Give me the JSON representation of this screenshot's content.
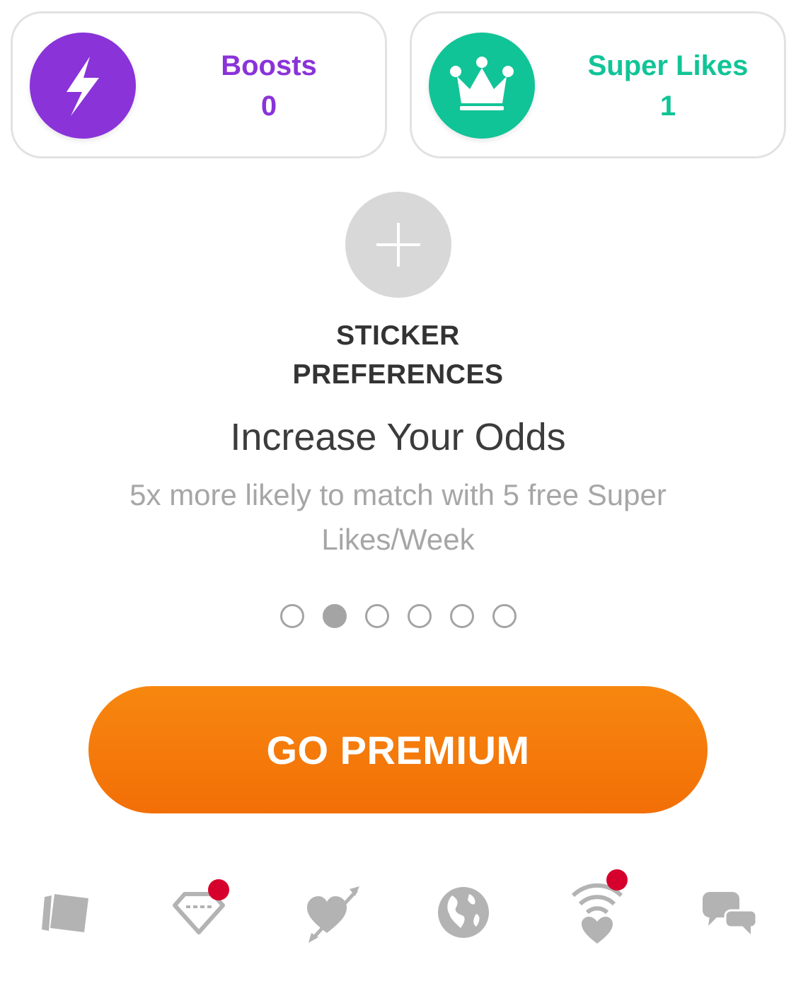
{
  "stats": {
    "boosts": {
      "label": "Boosts",
      "count": "0",
      "icon": "lightning-icon",
      "color": "#8a33d9"
    },
    "super_likes": {
      "label": "Super Likes",
      "count": "1",
      "icon": "crown-icon",
      "color": "#11c497"
    }
  },
  "sticker": {
    "icon": "plus-icon",
    "title_line1": "STICKER",
    "title_line2": "PREFERENCES"
  },
  "promo": {
    "title": "Increase Your Odds",
    "subtitle": "5x more likely to match with 5 free Super Likes/Week"
  },
  "pager": {
    "total": 6,
    "active_index": 1
  },
  "premium_button": {
    "label": "GO PREMIUM",
    "color": "#f47b0b"
  },
  "bottom_nav": [
    {
      "name": "cards-icon",
      "has_notification": false
    },
    {
      "name": "diamond-icon",
      "has_notification": true
    },
    {
      "name": "heart-arrow-icon",
      "has_notification": false
    },
    {
      "name": "globe-icon",
      "has_notification": false
    },
    {
      "name": "heart-signal-icon",
      "has_notification": true
    },
    {
      "name": "chat-bubbles-icon",
      "has_notification": false
    }
  ],
  "colors": {
    "notification": "#d6002c",
    "inactive_icon": "#b3b3b3"
  }
}
